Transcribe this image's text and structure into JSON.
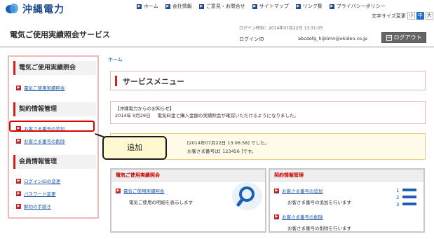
{
  "brand": {
    "name": "沖縄電力"
  },
  "topnav": [
    {
      "label": "ホーム"
    },
    {
      "label": "会社情報"
    },
    {
      "label": "ご意見・お問合せ"
    },
    {
      "label": "サイトマップ"
    },
    {
      "label": "リンク集"
    },
    {
      "label": "プライバシーポリシー"
    }
  ],
  "font_size": {
    "label": "文字サイズ変更",
    "small": "小",
    "medium": "中",
    "large": "大"
  },
  "service_title": "電気ご使用実績照会サービス",
  "login": {
    "datetime": "ログイン時刻：2014年07月22日 13:31:05",
    "id_label": "ログインID",
    "id_value": "abcdefg_hijklmn@okiden.co.jp",
    "logout_label": "ログアウト"
  },
  "sidebar": {
    "sections": [
      {
        "title": "電気ご使用実績照会",
        "links": [
          {
            "label": "電気ご使用実績照会"
          }
        ]
      },
      {
        "title": "契約情報管理",
        "links": [
          {
            "label": "お客さま番号の追加"
          },
          {
            "label": "お客さま番号の削除"
          }
        ]
      },
      {
        "title": "会員情報管理",
        "links": [
          {
            "label": "ログインIDの変更"
          },
          {
            "label": "パスワード変更"
          },
          {
            "label": "解約の手続き"
          }
        ]
      }
    ]
  },
  "breadcrumb": "ホーム",
  "page_title": "サービスメニュー",
  "notice": {
    "heading": "【沖縄電力からのお知らせ】",
    "date": "2014年 9月29日",
    "text": "電気料金と購入金額の実績照会が確認いただけるようになりました。"
  },
  "last_login": {
    "line1": "[2014年07月22日 13:06:58] でした。",
    "line2": "お客さま番号は[ 123456 ]です。"
  },
  "callout": "追加",
  "cards": {
    "usage": {
      "title": "電気ご使用実績照会",
      "link": "電気ご使用実績照会",
      "desc": "電気ご使用の明細を表示します"
    },
    "contract": {
      "title": "契約情報管理",
      "items": [
        {
          "link": "お客さま番号の追加",
          "desc": "お客さま番号の追加を行います"
        },
        {
          "link": "お客さま番号の削除",
          "desc": "お客さま番号の削除を行います"
        }
      ]
    }
  },
  "colors": {
    "accent_red": "#d81b1b",
    "brand_blue": "#1e4b8f",
    "link_blue": "#1f5aa8"
  }
}
